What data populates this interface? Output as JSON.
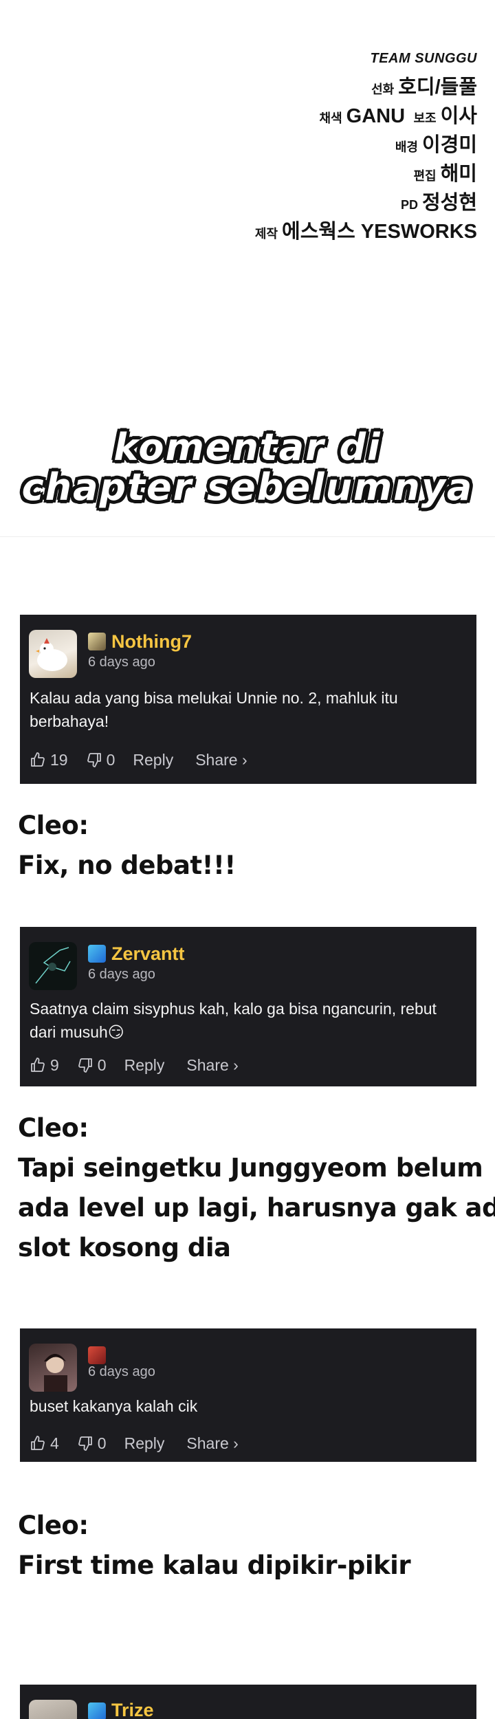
{
  "credits": {
    "team": "TEAM SUNGGU",
    "lines": [
      {
        "role": "선화",
        "name": "호디/들풀"
      },
      {
        "role": "채색",
        "name": "GANU",
        "role2": "보조",
        "name2": "이사"
      },
      {
        "role": "배경",
        "name": "이경미"
      },
      {
        "role": "편집",
        "name": "해미"
      },
      {
        "role": "PD",
        "name": "정성현"
      },
      {
        "role": "제작",
        "name": "에스웍스 YESWORKS"
      }
    ]
  },
  "title": {
    "line1": "komentar di",
    "line2": "chapter sebelumnya"
  },
  "comments": [
    {
      "username": "Nothing7",
      "username_color": "#f5c542",
      "time": "6 days ago",
      "text": "Kalau ada yang bisa melukai Unnie no. 2, mahluk itu berbahaya!",
      "likes": "19",
      "dislikes": "0",
      "reply": "Reply",
      "share": "Share ›"
    },
    {
      "username": "Zervantt",
      "username_color": "#f5c542",
      "time": "6 days ago",
      "text": "Saatnya claim sisyphus kah, kalo ga bisa ngancurin, rebut dari musuh😏",
      "likes": "9",
      "dislikes": "0",
      "reply": "Reply",
      "share": "Share ›"
    },
    {
      "username": "",
      "time": "6 days ago",
      "text": "buset kakanya kalah cik",
      "likes": "4",
      "dislikes": "0",
      "reply": "Reply",
      "share": "Share ›"
    },
    {
      "username": "Trize",
      "username_color": "#f5c542"
    }
  ],
  "cleo_notes": [
    {
      "speaker": "Cleo:",
      "lines": [
        "Fix, no debat!!!"
      ]
    },
    {
      "speaker": "Cleo:",
      "lines": [
        "Tapi seingetku Junggyeom belum",
        "ada level up lagi, harusnya gak ada",
        "slot kosong dia"
      ]
    },
    {
      "speaker": "Cleo:",
      "lines": [
        "First time kalau dipikir-pikir"
      ]
    }
  ],
  "colors": {
    "card_bg": "#1c1c20",
    "username": "#f5c542",
    "meta_text": "#b9b9bf"
  },
  "icons": [
    "thumbs-up-icon",
    "thumbs-down-icon",
    "user-badge-icon",
    "avatar-image"
  ]
}
